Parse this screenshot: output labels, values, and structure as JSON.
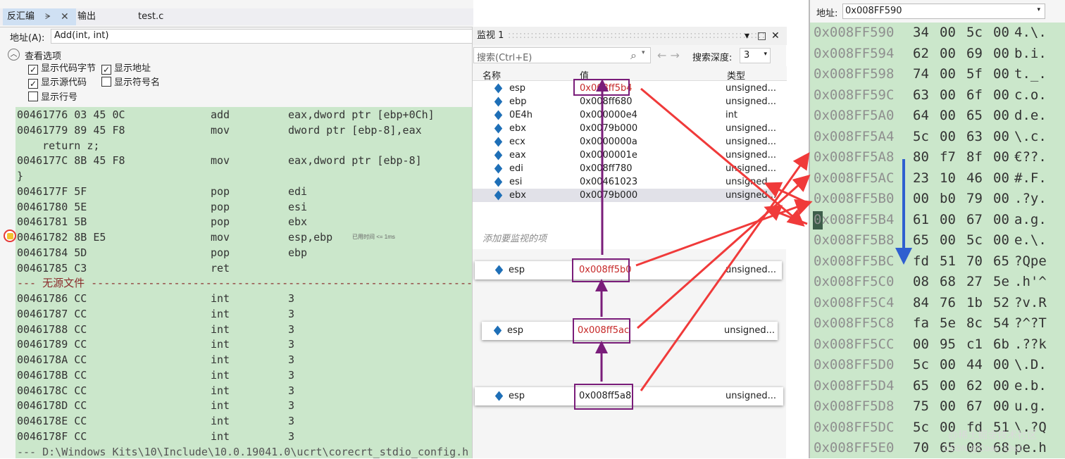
{
  "tabs": {
    "disasm": "反汇编",
    "pin": "ᗒ",
    "close": "✕",
    "output": "输出",
    "source": "test.c"
  },
  "addr": {
    "label": "地址(A):",
    "value": "Add(int, int)"
  },
  "view": {
    "title": "查看选项",
    "opt1": "显示代码字节",
    "opt2": "显示地址",
    "opt3": "显示源代码",
    "opt4": "显示符号名",
    "opt5": "显示行号"
  },
  "code": [
    {
      "a": "00461776 03 45 0C",
      "m": "add",
      "o": "eax,dword ptr [ebp+0Ch]"
    },
    {
      "a": "00461779 89 45 F8",
      "m": "mov",
      "o": "dword ptr [ebp-8],eax"
    },
    {
      "s": "    return z;"
    },
    {
      "a": "0046177C 8B 45 F8",
      "m": "mov",
      "o": "eax,dword ptr [ebp-8]"
    },
    {
      "s": "}"
    },
    {
      "a": "0046177F 5F",
      "m": "pop",
      "o": "edi"
    },
    {
      "a": "00461780 5E",
      "m": "pop",
      "o": "esi"
    },
    {
      "a": "00461781 5B",
      "m": "pop",
      "o": "ebx"
    },
    {
      "a": "00461782 8B E5",
      "m": "mov",
      "o": "esp,ebp",
      "tiny": "已用时间 <= 1ms"
    },
    {
      "a": "00461784 5D",
      "m": "pop",
      "o": "ebp"
    },
    {
      "a": "00461785 C3",
      "m": "ret",
      "o": ""
    },
    {
      "sep": "--- 无源文件 -------------------------------------------------------------------"
    },
    {
      "a": "00461786 CC",
      "m": "int",
      "o": "3"
    },
    {
      "a": "00461787 CC",
      "m": "int",
      "o": "3"
    },
    {
      "a": "00461788 CC",
      "m": "int",
      "o": "3"
    },
    {
      "a": "00461789 CC",
      "m": "int",
      "o": "3"
    },
    {
      "a": "0046178A CC",
      "m": "int",
      "o": "3"
    },
    {
      "a": "0046178B CC",
      "m": "int",
      "o": "3"
    },
    {
      "a": "0046178C CC",
      "m": "int",
      "o": "3"
    },
    {
      "a": "0046178D CC",
      "m": "int",
      "o": "3"
    },
    {
      "a": "0046178E CC",
      "m": "int",
      "o": "3"
    },
    {
      "a": "0046178F CC",
      "m": "int",
      "o": "3"
    },
    {
      "file": "--- D:\\Windows Kits\\10\\Include\\10.0.19041.0\\ucrt\\corecrt_stdio_config.h"
    }
  ],
  "watch": {
    "title": "监视 1",
    "search": "搜索(Ctrl+E)",
    "search_icon": "⌕",
    "nav": "← →",
    "depth_label": "搜索深度:",
    "depth": "3",
    "col_name": "名称",
    "col_value": "值",
    "col_type": "类型",
    "rows": [
      {
        "n": "esp",
        "v": "0x008ff5b4",
        "t": "unsigned..."
      },
      {
        "n": "ebp",
        "v": "0x008ff680",
        "t": "unsigned..."
      },
      {
        "n": "0E4h",
        "v": "0x000000e4",
        "t": "int"
      },
      {
        "n": "ebx",
        "v": "0x0079b000",
        "t": "unsigned..."
      },
      {
        "n": "ecx",
        "v": "0x0000000a",
        "t": "unsigned..."
      },
      {
        "n": "eax",
        "v": "0x0000001e",
        "t": "unsigned..."
      },
      {
        "n": "edi",
        "v": "0x008ff780",
        "t": "unsigned..."
      },
      {
        "n": "esi",
        "v": "0x00461023",
        "t": "unsigned..."
      },
      {
        "n": "ebx",
        "v": "0x0079b000",
        "t": "unsigned..."
      }
    ],
    "add": "添加要监视的项",
    "cards": [
      {
        "n": "esp",
        "v": "0x008ff5b0",
        "t": "unsigned..."
      },
      {
        "n": "esp",
        "v": "0x008ff5ac",
        "t": "unsigned..."
      },
      {
        "n": "esp",
        "v": "0x008ff5a8",
        "t": "unsigned..."
      }
    ]
  },
  "memory": {
    "label": "地址:",
    "value": "0x008FF590",
    "rows": [
      {
        "a": "0x008FF590",
        "b": [
          "34",
          "00",
          "5c",
          "00"
        ],
        "c": "4.\\."
      },
      {
        "a": "0x008FF594",
        "b": [
          "62",
          "00",
          "69",
          "00"
        ],
        "c": "b.i."
      },
      {
        "a": "0x008FF598",
        "b": [
          "74",
          "00",
          "5f",
          "00"
        ],
        "c": "t._."
      },
      {
        "a": "0x008FF59C",
        "b": [
          "63",
          "00",
          "6f",
          "00"
        ],
        "c": "c.o."
      },
      {
        "a": "0x008FF5A0",
        "b": [
          "64",
          "00",
          "65",
          "00"
        ],
        "c": "d.e."
      },
      {
        "a": "0x008FF5A4",
        "b": [
          "5c",
          "00",
          "63",
          "00"
        ],
        "c": "\\.c."
      },
      {
        "a": "0x008FF5A8",
        "b": [
          "80",
          "f7",
          "8f",
          "00"
        ],
        "c": "€??."
      },
      {
        "a": "0x008FF5AC",
        "b": [
          "23",
          "10",
          "46",
          "00"
        ],
        "c": "#.F."
      },
      {
        "a": "0x008FF5B0",
        "b": [
          "00",
          "b0",
          "79",
          "00"
        ],
        "c": ".?y."
      },
      {
        "a": "0x008FF5B4",
        "b": [
          "61",
          "00",
          "67",
          "00"
        ],
        "c": "a.g."
      },
      {
        "a": "0x008FF5B8",
        "b": [
          "65",
          "00",
          "5c",
          "00"
        ],
        "c": "e.\\."
      },
      {
        "a": "0x008FF5BC",
        "b": [
          "fd",
          "51",
          "70",
          "65"
        ],
        "c": "?Qpe"
      },
      {
        "a": "0x008FF5C0",
        "b": [
          "08",
          "68",
          "27",
          "5e"
        ],
        "c": ".h'^"
      },
      {
        "a": "0x008FF5C4",
        "b": [
          "84",
          "76",
          "1b",
          "52"
        ],
        "c": "?v.R"
      },
      {
        "a": "0x008FF5C8",
        "b": [
          "fa",
          "5e",
          "8c",
          "54"
        ],
        "c": "?^?T"
      },
      {
        "a": "0x008FF5CC",
        "b": [
          "00",
          "95",
          "c1",
          "6b"
        ],
        "c": ".??k"
      },
      {
        "a": "0x008FF5D0",
        "b": [
          "5c",
          "00",
          "44",
          "00"
        ],
        "c": "\\.D."
      },
      {
        "a": "0x008FF5D4",
        "b": [
          "65",
          "00",
          "62",
          "00"
        ],
        "c": "e.b."
      },
      {
        "a": "0x008FF5D8",
        "b": [
          "75",
          "00",
          "67",
          "00"
        ],
        "c": "u.g."
      },
      {
        "a": "0x008FF5DC",
        "b": [
          "5c",
          "00",
          "fd",
          "51"
        ],
        "c": "\\.?Q"
      },
      {
        "a": "0x008FF5E0",
        "b": [
          "70",
          "65",
          "08",
          "68"
        ],
        "c": "pe.h"
      }
    ]
  },
  "watermark": "@稀土掘金技术社区",
  "watermark2": "CSDN @Code_Chal",
  "colors": {
    "code_bg": "#cbe7cb",
    "annot_red": "#e53935",
    "annot_purple": "#7a1d7a",
    "arrow_blue": "#2f5fd0"
  }
}
